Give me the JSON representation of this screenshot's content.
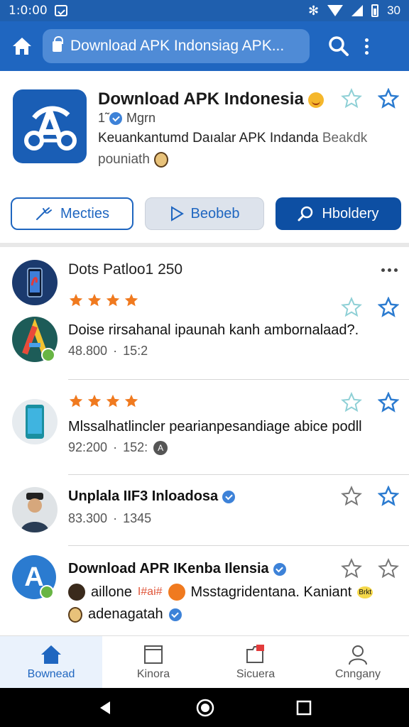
{
  "status_bar": {
    "time": "1:0:00",
    "battery": "30"
  },
  "toolbar": {
    "url": "Download APK Indonsiag APK..."
  },
  "hero": {
    "title": "Download APK Indonesia",
    "developer_prefix": "1̃",
    "developer": "Mgrn",
    "desc_main": "Keuankantumd Daıalar APK Indanda",
    "desc_muted": "Beakdk",
    "desc_second": "pouniath"
  },
  "buttons": {
    "mecties": "Mecties",
    "beobeb": "Beobeb",
    "hbolder": "Hboldery"
  },
  "feed": {
    "header": "Dots Patloo1 250",
    "item1": {
      "body": "Doise rirsahanal ipaunah kanh ambornalaad?.",
      "meta_count": "48.800",
      "meta_time": "15:2"
    },
    "item2": {
      "body": "Mlssalhatlincler pearianpesandiage abice podll",
      "meta_count": "92:200",
      "meta_time": "152:"
    },
    "item3": {
      "title": "Unplala IIF3 Inloadosa",
      "meta_count": "83.300",
      "meta_time": "1345"
    },
    "item4": {
      "title": "Download APR IKenba Ilensia",
      "user": "aillone",
      "tag": "I#ai#",
      "body": "Msstagridentana. Kaniant",
      "author": "adenagatah",
      "sticker": "Brkt"
    }
  },
  "bottom_nav": [
    {
      "label": "Bownead"
    },
    {
      "label": "Kinora"
    },
    {
      "label": "Sicuera"
    },
    {
      "label": "Cnngany"
    }
  ],
  "colors": {
    "primary": "#1f66c0",
    "status": "#1f5fae",
    "star_orange": "#f07a1f",
    "star_outline_teal": "#8fd0d6",
    "star_outline_blue": "#2b7bd0"
  }
}
